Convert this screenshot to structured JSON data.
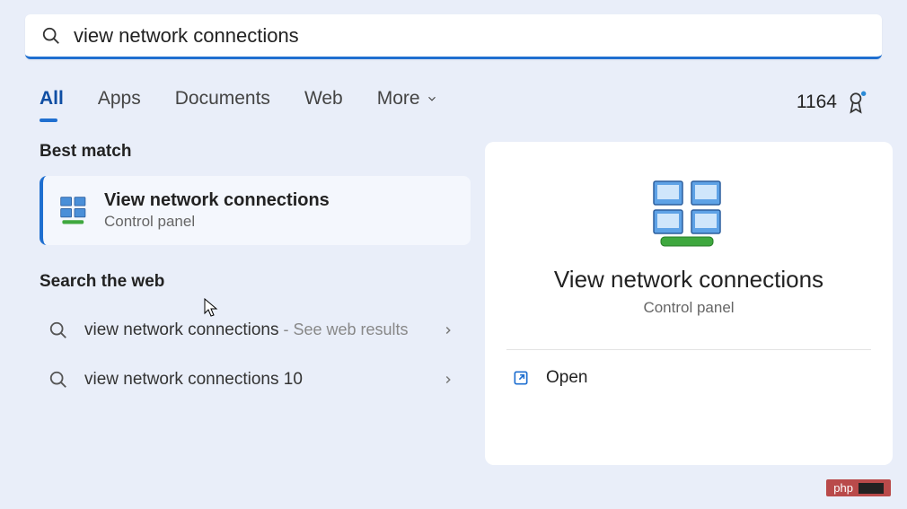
{
  "search": {
    "query": "view network connections"
  },
  "tabs": {
    "all": "All",
    "apps": "Apps",
    "documents": "Documents",
    "web": "Web",
    "more": "More"
  },
  "rewards": {
    "points": "1164"
  },
  "left": {
    "best_match_label": "Best match",
    "best_match": {
      "title": "View network connections",
      "subtitle": "Control panel"
    },
    "web_label": "Search the web",
    "web_items": [
      {
        "text": "view network connections",
        "suffix": " - See web results"
      },
      {
        "text": "view network connections 10",
        "suffix": ""
      }
    ]
  },
  "right": {
    "title": "View network connections",
    "subtitle": "Control panel",
    "open": "Open"
  },
  "badge": {
    "text": "php"
  }
}
